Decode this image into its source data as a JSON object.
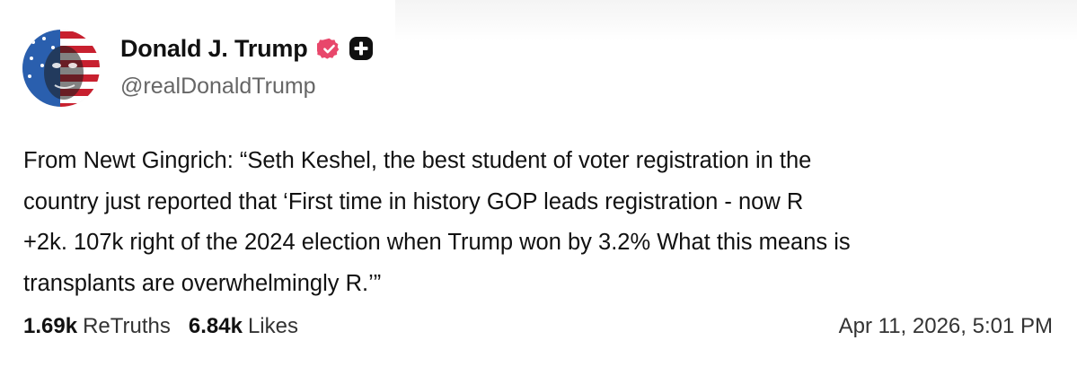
{
  "profile": {
    "display_name": "Donald J. Trump",
    "handle": "@realDonaldTrump",
    "verified_color": "#e8476b",
    "icons": [
      "verified-badge-icon",
      "plus-icon"
    ]
  },
  "post": {
    "text": "From Newt Gingrich: “Seth Keshel, the best student of voter registration in the\ncountry just reported that ‘First time in history GOP leads registration - now R\n+2k. 107k right of the 2024 election when Trump won by 3.2% What this means is\ntransplants are overwhelmingly R.’”",
    "timestamp": "Apr 11, 2026, 5:01 PM"
  },
  "stats": {
    "retruths_count": "1.69k",
    "retruths_label": "ReTruths",
    "likes_count": "6.84k",
    "likes_label": "Likes"
  }
}
